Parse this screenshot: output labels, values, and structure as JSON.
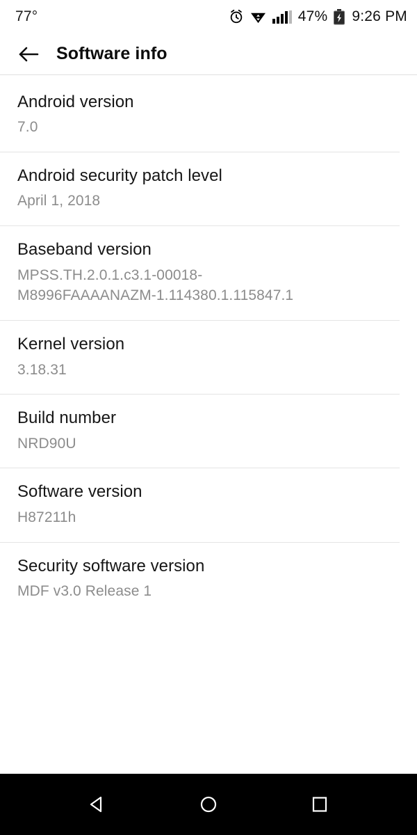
{
  "status_bar": {
    "temperature": "77°",
    "alarm_icon": "alarm-clock-icon",
    "wifi_icon": "wifi-icon",
    "signal_icon": "cellular-signal-icon",
    "battery_percent": "47%",
    "battery_icon": "battery-charging-icon",
    "clock": "9:26 PM"
  },
  "appbar": {
    "back_icon": "back-arrow-icon",
    "title": "Software info"
  },
  "list": {
    "items": [
      {
        "title": "Android version",
        "value": "7.0"
      },
      {
        "title": "Android security patch level",
        "value": "April 1, 2018"
      },
      {
        "title": "Baseband version",
        "value": "MPSS.TH.2.0.1.c3.1-00018-M8996FAAAANAZM-1.114380.1.115847.1"
      },
      {
        "title": "Kernel version",
        "value": "3.18.31"
      },
      {
        "title": "Build number",
        "value": "NRD90U"
      },
      {
        "title": "Software version",
        "value": "H87211h"
      },
      {
        "title": "Security software version",
        "value": "MDF v3.0 Release 1"
      }
    ]
  },
  "navbar": {
    "back_icon": "nav-back-triangle-icon",
    "home_icon": "nav-home-circle-icon",
    "recents_icon": "nav-recents-square-icon"
  },
  "colors": {
    "background": "#ffffff",
    "primary_text": "#161616",
    "secondary_text": "#8c8c8c",
    "divider": "#e4e4e4",
    "navbar_background": "#000000"
  }
}
